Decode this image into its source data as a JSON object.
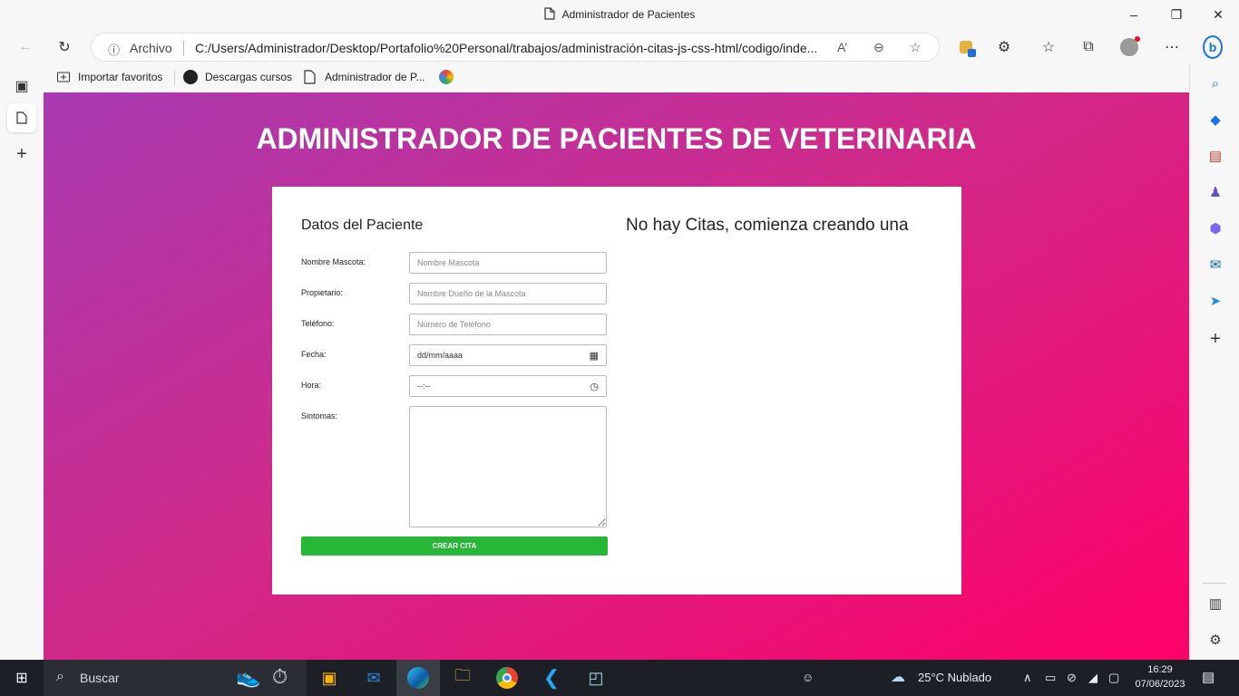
{
  "window": {
    "title": "Administrador de Pacientes"
  },
  "addressbar": {
    "security_label": "Archivo",
    "url": "C:/Users/Administrador/Desktop/Portafolio%20Personal/trabajos/administración-citas-js-css-html/codigo/inde..."
  },
  "favorites": [
    {
      "label": "Importar favoritos",
      "icon": "import-icon"
    },
    {
      "label": "Descargas cursos",
      "icon": "site-icon"
    },
    {
      "label": "Administrador de P...",
      "icon": "doc-icon"
    }
  ],
  "page": {
    "heading": "ADMINISTRADOR DE PACIENTES DE VETERINARIA",
    "form_title": "Datos del Paciente",
    "citas_title": "No hay Citas, comienza creando una",
    "fields": {
      "mascota": {
        "label": "Nombre Mascota:",
        "placeholder": "Nombre Mascota"
      },
      "propietario": {
        "label": "Propietario:",
        "placeholder": "Nombre Dueño de la Mascota"
      },
      "telefono": {
        "label": "Teléfono:",
        "placeholder": "Número de Teléfono"
      },
      "fecha": {
        "label": "Fecha:",
        "placeholder": "dd/mm/aaaa"
      },
      "hora": {
        "label": "Hora:",
        "placeholder": "--:--"
      },
      "sintomas": {
        "label": "Sintomas:"
      }
    },
    "submit_label": "CREAR CITA",
    "colors": {
      "gradient_start": "#a83ab1",
      "gradient_end": "#ff0068",
      "button": "#27b737"
    }
  },
  "taskbar": {
    "search_label": "Buscar",
    "weather": "25°C  Nublado",
    "time": "16:29",
    "date": "07/06/2023"
  }
}
